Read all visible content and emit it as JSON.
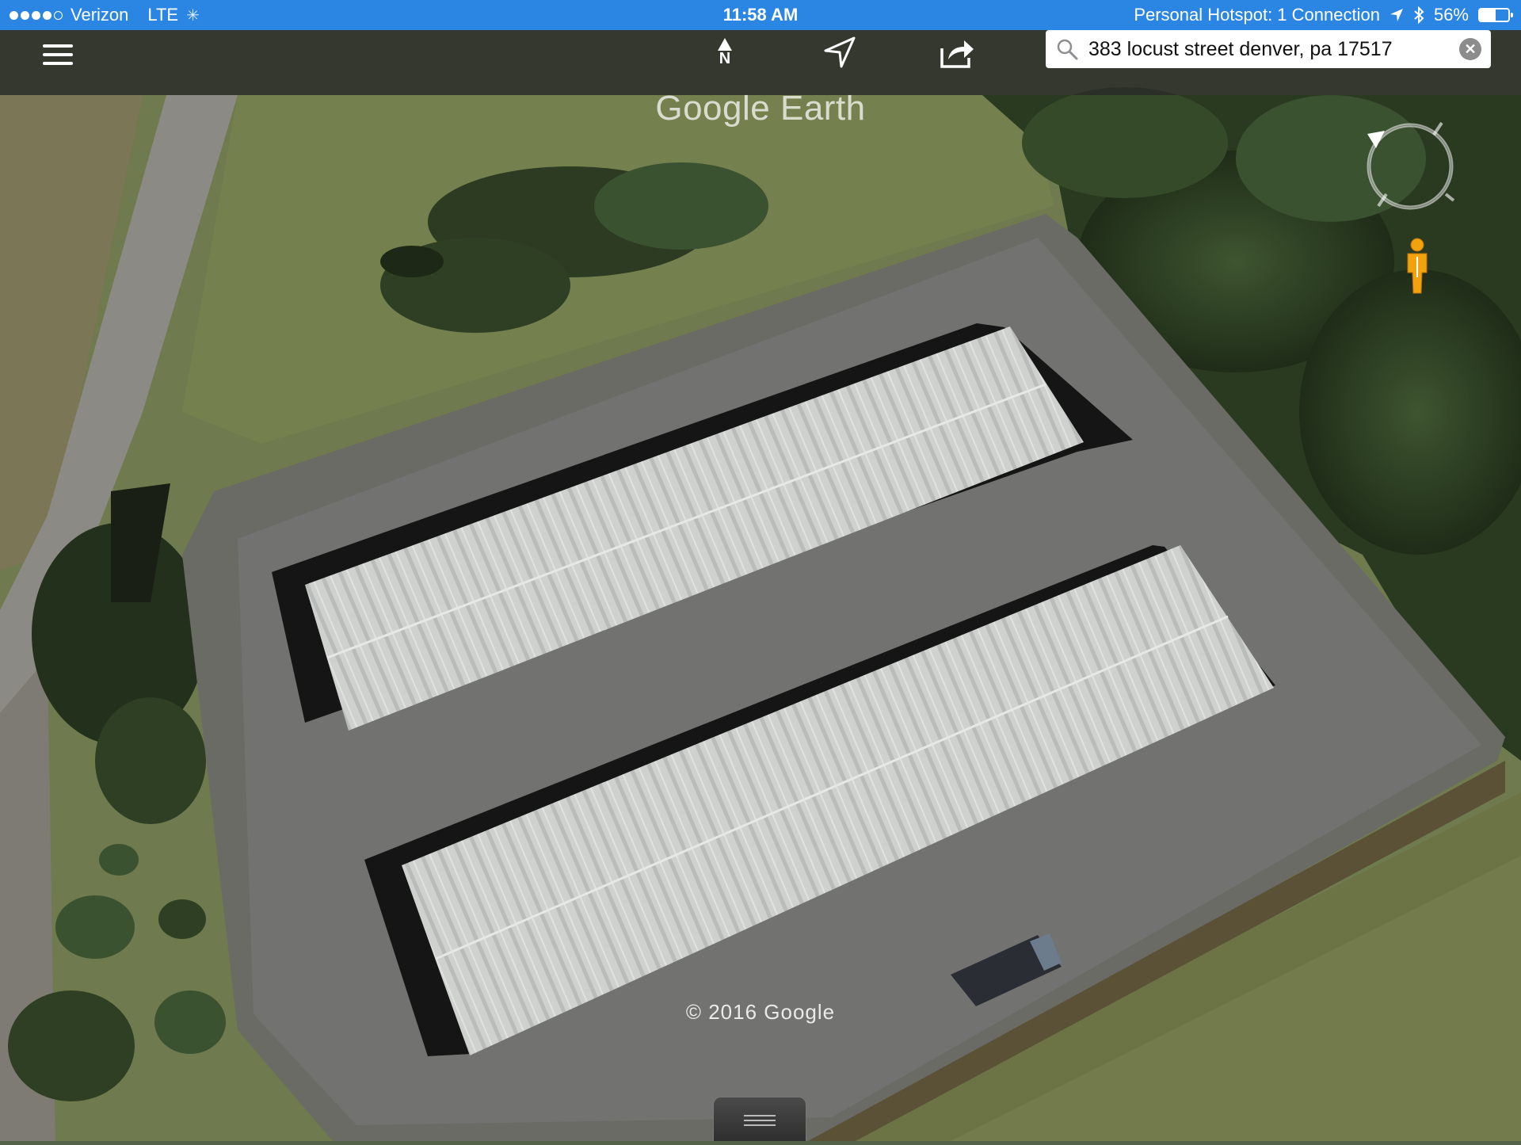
{
  "status_bar": {
    "carrier": "Verizon",
    "network": "LTE",
    "time": "11:58 AM",
    "hotspot": "Personal Hotspot: 1 Connection",
    "battery": "56%",
    "battery_level": 0.56
  },
  "toolbar": {
    "menu_icon": "hamburger-menu-icon",
    "north_label": "N",
    "location_icon": "location-arrow-icon",
    "share_icon": "share-icon"
  },
  "search": {
    "value": "383 locust street denver, pa 17517",
    "clear_icon": "close-icon"
  },
  "map": {
    "brand": "Google Earth",
    "copyright": "© 2016 Google"
  },
  "colors": {
    "status_bar": "#2b86e3",
    "toolbar": "#282a28",
    "roof": "#cfd1cf",
    "gravel": "#6b6b66",
    "grass": "#6f7a4e",
    "trees": "#2e3f24",
    "pegman": "#f2a20c"
  }
}
